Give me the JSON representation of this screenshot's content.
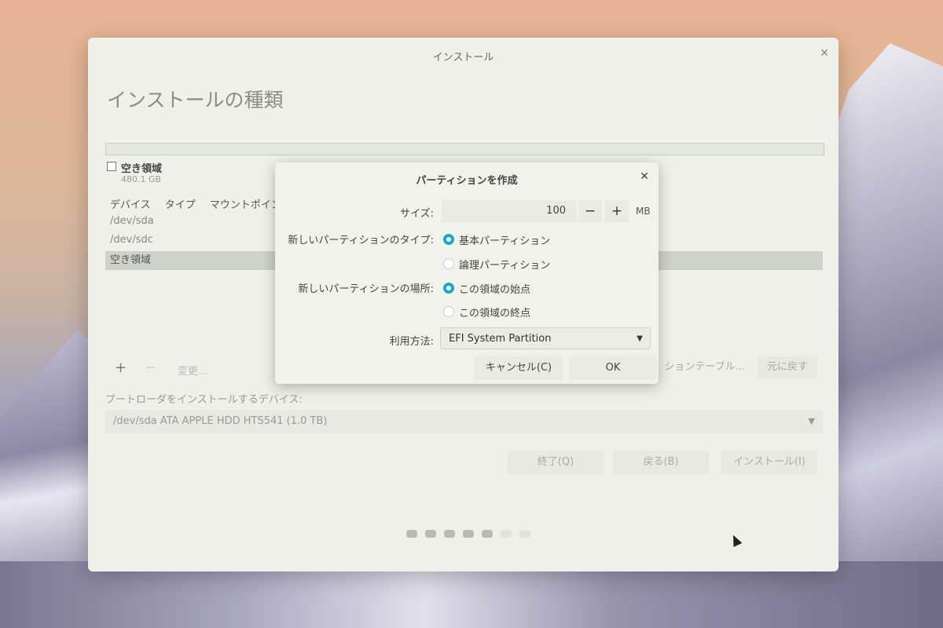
{
  "window": {
    "title": "インストール",
    "page_title": "インストールの種類",
    "free_space": {
      "label": "空き領域",
      "size": "480.1 GB"
    },
    "table": {
      "headers": [
        "デバイス",
        "タイプ",
        "マウントポイン"
      ],
      "rows": [
        "/dev/sda",
        "/dev/sdc",
        "空き領域"
      ]
    },
    "toolbar": {
      "add": "+",
      "remove": "−",
      "change": "変更...",
      "new_table": "ションテーブル...",
      "revert": "元に戻す"
    },
    "bootloader": {
      "label": "ブートローダをインストールするデバイス:",
      "value": "/dev/sda ATA APPLE HDD HTS541 (1.0 TB)"
    },
    "buttons": {
      "quit": "終了(Q)",
      "back": "戻る(B)",
      "install": "インストール(I)"
    },
    "progress": {
      "total": 7,
      "current": 5
    }
  },
  "dialog": {
    "title": "パーティションを作成",
    "size_label": "サイズ:",
    "size_value": "100",
    "minus": "−",
    "plus": "+",
    "unit": "MB",
    "type_label": "新しいパーティションのタイプ:",
    "type_primary": "基本パーティション",
    "type_logical": "論理パーティション",
    "location_label": "新しいパーティションの場所:",
    "location_start": "この領域の始点",
    "location_end": "この領域の終点",
    "use_label": "利用方法:",
    "use_value": "EFI System Partition",
    "cancel": "キャンセル(C)",
    "ok": "OK"
  },
  "colors": {
    "accent": "#1aa8c2",
    "selected_row": "#cfd1cb"
  }
}
